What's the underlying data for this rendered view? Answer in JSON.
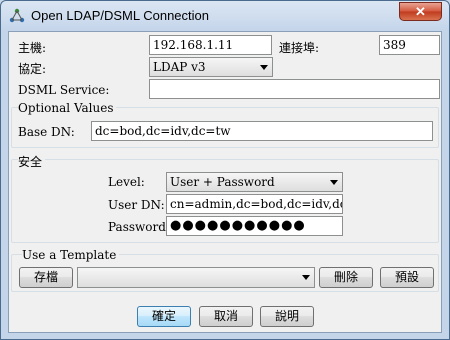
{
  "window": {
    "title": "Open LDAP/DSML Connection",
    "close_glyph": "✕"
  },
  "connection": {
    "host_label": "主機:",
    "host_value": "192.168.1.11",
    "port_label": "連接埠:",
    "port_value": "389",
    "protocol_label": "協定:",
    "protocol_value": "LDAP v3",
    "dsml_label": "DSML Service:",
    "dsml_value": ""
  },
  "optional": {
    "legend": "Optional Values",
    "base_dn_label": "Base DN:",
    "base_dn_value": "dc=bod,dc=idv,dc=tw"
  },
  "security": {
    "legend": "安全",
    "level_label": "Level:",
    "level_value": "User + Password",
    "user_dn_label": "User DN:",
    "user_dn_value": "cn=admin,dc=bod,dc=idv,dc=tw",
    "password_label": "Password:",
    "password_mask": "●●●●●●●●●●●"
  },
  "template": {
    "legend": "Use a Template",
    "save_label": "存檔",
    "template_value": "",
    "delete_label": "刪除",
    "default_label": "預設"
  },
  "actions": {
    "ok_label": "確定",
    "cancel_label": "取消",
    "help_label": "說明"
  },
  "icons": {
    "app_icon": "network-icon",
    "close_icon": "close-icon"
  }
}
